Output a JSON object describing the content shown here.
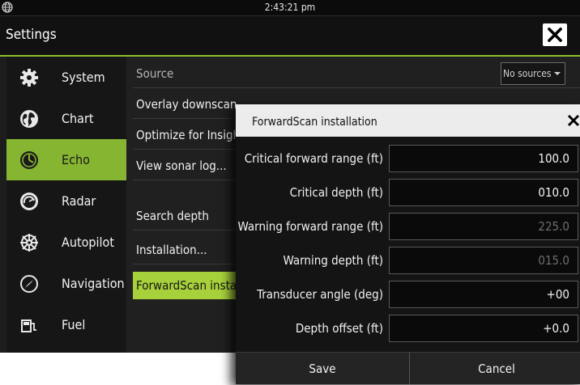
{
  "status": {
    "time": "2:43:21 pm",
    "left_icon": "globe-icon"
  },
  "header": {
    "title": "Settings",
    "close_icon": "close-icon"
  },
  "sidebar": {
    "items": [
      {
        "label": "System",
        "icon": "gear-icon",
        "active": false
      },
      {
        "label": "Chart",
        "icon": "globe-chart-icon",
        "active": false
      },
      {
        "label": "Echo",
        "icon": "echo-dial-icon",
        "active": true
      },
      {
        "label": "Radar",
        "icon": "radar-icon",
        "active": false
      },
      {
        "label": "Autopilot",
        "icon": "helm-icon",
        "active": false
      },
      {
        "label": "Navigation",
        "icon": "compass-icon",
        "active": false
      },
      {
        "label": "Fuel",
        "icon": "fuel-pump-icon",
        "active": false
      }
    ]
  },
  "main": {
    "source": {
      "label": "Source",
      "dropdown_value": "No sources"
    },
    "rows": [
      {
        "label": "Overlay downscan"
      },
      {
        "label": "Optimize for Insight"
      },
      {
        "label": "View sonar log..."
      },
      {
        "label": "Search depth"
      },
      {
        "label": "Installation..."
      },
      {
        "label": "ForwardScan installation",
        "selected": true
      }
    ]
  },
  "dialog": {
    "title": "ForwardScan installation",
    "fields": [
      {
        "label": "Critical forward range (ft)",
        "value": "100.0",
        "enabled": true
      },
      {
        "label": "Critical depth (ft)",
        "value": "010.0",
        "enabled": true
      },
      {
        "label": "Warning forward range (ft)",
        "value": "225.0",
        "enabled": false
      },
      {
        "label": "Warning depth (ft)",
        "value": "015.0",
        "enabled": false
      },
      {
        "label": "Transducer angle (deg)",
        "value": "+00",
        "enabled": true
      },
      {
        "label": "Depth offset (ft)",
        "value": "+0.0",
        "enabled": true
      }
    ],
    "save_label": "Save",
    "cancel_label": "Cancel"
  },
  "colors": {
    "accent": "#86b531",
    "selected_row": "#a7d13b",
    "background": "#1d1d1d"
  }
}
